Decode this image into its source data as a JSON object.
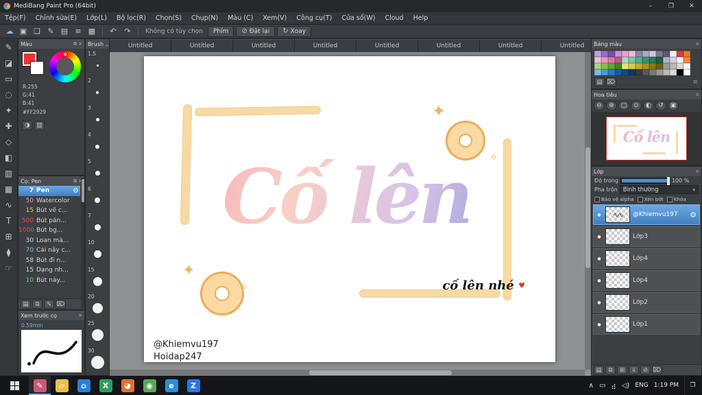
{
  "icons": {
    "close": "×",
    "collapse": "⧉",
    "gear": "⚙",
    "eye": "●",
    "caret": "▾",
    "undo": "↶",
    "redo": "↷",
    "block": "⊘",
    "rotate": "↻",
    "handle": "≡",
    "sparkle": "✦",
    "sparkle_small": "✧",
    "heart": "♥",
    "action_center": "❐"
  },
  "titlebar": {
    "title": "MediBang Paint Pro (64bit)",
    "window_buttons": {
      "minimize": "–",
      "maximize": "❐",
      "close": "✕"
    }
  },
  "menu": {
    "items": [
      "Tệp(F)",
      "Chỉnh sửa(E)",
      "Lớp(L)",
      "Bộ lọc(R)",
      "Chọn(S)",
      "Chụp(N)",
      "Màu (C)",
      "Xem(V)",
      "Công cụ(T)",
      "Cửa sổ(W)",
      "Cloud",
      "Help"
    ]
  },
  "toolbar": {
    "icons": [
      {
        "name": "cloud-icon",
        "glyph": "☁"
      },
      {
        "name": "save-icon",
        "glyph": "▣"
      },
      {
        "name": "comment-icon",
        "glyph": "❏"
      },
      {
        "name": "brush-icon",
        "glyph": "✎"
      },
      {
        "name": "material-icon",
        "glyph": "▤"
      },
      {
        "name": "list-icon",
        "glyph": "≡"
      },
      {
        "name": "grid-icon",
        "glyph": "▦"
      }
    ],
    "no_option_label": "Không có tùy chọn",
    "keys_button": "Phím",
    "reset_button": "Đặt lại",
    "rotate_button": "Xoay"
  },
  "tabs": [
    "Untitled",
    "Untitled",
    "Untitled",
    "Untitled",
    "Untitled",
    "Untitled",
    "Untitled",
    "Untitled"
  ],
  "tools": [
    {
      "name": "pen-tool",
      "glyph": "✎"
    },
    {
      "name": "eraser-tool",
      "glyph": "◪"
    },
    {
      "name": "select-tool",
      "glyph": "▭"
    },
    {
      "name": "lasso-tool",
      "glyph": "◌"
    },
    {
      "name": "magic-wand-tool",
      "glyph": "✦"
    },
    {
      "name": "move-tool",
      "glyph": "✚"
    },
    {
      "name": "transform-tool",
      "glyph": "◇"
    },
    {
      "name": "bucket-tool",
      "glyph": "◧"
    },
    {
      "name": "gradient-tool",
      "glyph": "▥"
    },
    {
      "name": "shape-tool",
      "glyph": "▦"
    },
    {
      "name": "curve-tool",
      "glyph": "∿"
    },
    {
      "name": "text-tool",
      "glyph": "T"
    },
    {
      "name": "frame-tool",
      "glyph": "⊞"
    },
    {
      "name": "eyedropper-tool",
      "glyph": "⧫"
    },
    {
      "name": "hand-tool",
      "glyph": "☞",
      "color": "#7fc4e8"
    }
  ],
  "color_panel": {
    "title": "Màu",
    "r": "R:255",
    "g": "G:41",
    "b": "B:41",
    "hex": "#FF2929",
    "foreground_color": "#ee3333",
    "background_color": "#ffffff",
    "bottom_icons": [
      {
        "name": "swap-colors-icon",
        "glyph": "◑"
      },
      {
        "name": "color-slider-icon",
        "glyph": "▥"
      }
    ]
  },
  "brush_panel": {
    "title": "Cọ: Pen",
    "brushes": [
      {
        "size": "7",
        "name": "Pen",
        "selected": true
      },
      {
        "size": "50",
        "name": "Watercolor",
        "size_color": "#e89ab8"
      },
      {
        "size": "15",
        "name": "Bút vẽ c...",
        "size_color": "#e8d44a"
      },
      {
        "size": "500",
        "name": "Bút pản...",
        "size_color": "#e84848"
      },
      {
        "size": "1000",
        "name": "Bút bg...",
        "size_color": "#e84848"
      },
      {
        "size": "30",
        "name": "Loan mà...",
        "size_color": "#d8d8d8"
      },
      {
        "size": "70",
        "name": "Cải nãy c...",
        "size_color": "#8fb8e8"
      },
      {
        "size": "58",
        "name": "Bút đi n...",
        "size_color": "#d8d8d8"
      },
      {
        "size": "15",
        "name": "Dạng nh...",
        "size_color": "#d8d8d8"
      },
      {
        "size": "10",
        "name": "Bút này...",
        "size_color": "#7ac84a"
      }
    ],
    "bottom_icons": [
      {
        "name": "new-brush-icon",
        "glyph": "▤"
      },
      {
        "name": "duplicate-brush-icon",
        "glyph": "⧉"
      },
      {
        "name": "edit-brush-icon",
        "glyph": "✎"
      },
      {
        "name": "delete-brush-icon",
        "glyph": "⌦"
      }
    ]
  },
  "size_panel": {
    "title": "Brush ...",
    "sizes": [
      {
        "label": "1.5",
        "dot": 3
      },
      {
        "label": "2",
        "dot": 4
      },
      {
        "label": "3",
        "dot": 5
      },
      {
        "label": "4",
        "dot": 6
      },
      {
        "label": "5",
        "dot": 7
      },
      {
        "label": "6",
        "dot": 8
      },
      {
        "label": "7",
        "dot": 9
      },
      {
        "label": "10",
        "dot": 11
      },
      {
        "label": "15",
        "dot": 13
      },
      {
        "label": "20",
        "dot": 15
      },
      {
        "label": "25",
        "dot": 17
      },
      {
        "label": "30",
        "dot": 19
      }
    ]
  },
  "preview_panel": {
    "title": "Xem trước cọ",
    "size_label": "0.59mm"
  },
  "palette_panel": {
    "title": "Bảng màu",
    "colors": [
      "#b9a3d8",
      "#9a6cc9",
      "#7b4cb2",
      "#c892d8",
      "#e8a2d0",
      "#f0bad8",
      "#8a8aa2",
      "#a9a9c1",
      "#c9c9e0",
      "#7a7a92",
      "#5a5a72",
      "#f0f0f0",
      "#e03a3a",
      "#e87a2a",
      "#f0c2d2",
      "#e89aba",
      "#d87a9a",
      "#c05a7a",
      "#aad8c2",
      "#7ac8a2",
      "#4ab282",
      "#3a926a",
      "#2a7a52",
      "#1a6242",
      "#b2b2c2",
      "#d2d2e2",
      "#f2f2fa",
      "#f08a3a",
      "#aad87a",
      "#82c252",
      "#5aaa32",
      "#3a8a1a",
      "#e8e272",
      "#d8ca4a",
      "#c2aa32",
      "#aa9222",
      "#8a7a12",
      "#6a620a",
      "#9a9a9a",
      "#bababa",
      "#dadada",
      "#fafafa",
      "#7abae8",
      "#4a9ada",
      "#2a7ac2",
      "#1a5aa2",
      "#124a82",
      "#0a3a62",
      "#3a3a3a",
      "#5a5a5a",
      "#7a7a7a",
      "#9a9a9a",
      "#bababa",
      "#dadada",
      "#000000",
      "#ffffff"
    ],
    "bottom_icons": [
      {
        "name": "add-swatch-icon",
        "glyph": "▤"
      },
      {
        "name": "delete-swatch-icon",
        "glyph": "⌦"
      }
    ]
  },
  "navigator_panel": {
    "title": "Hoa tiêu",
    "tools": [
      {
        "name": "zoom-out-icon",
        "glyph": "⊖"
      },
      {
        "name": "zoom-in-icon",
        "glyph": "⊕"
      },
      {
        "name": "fit-window-icon",
        "glyph": "▢"
      },
      {
        "name": "original-size-icon",
        "glyph": "⊙"
      },
      {
        "name": "rotate-reset-icon",
        "glyph": "◐"
      },
      {
        "name": "rotate-ccw-icon",
        "glyph": "↺"
      },
      {
        "name": "fullscreen-icon",
        "glyph": "▣"
      }
    ]
  },
  "layers_panel": {
    "title": "Lớp",
    "opacity_label": "Độ trong",
    "opacity_value": "100 %",
    "blend_label": "Pha trộn",
    "blend_value": "Bình thường",
    "alpha_lock_label": "Bảo vệ alpha",
    "clip_label": "Xén bớt",
    "lock_label": "Khóa",
    "layers": [
      {
        "name": "@Khiemvu197",
        "selected": true
      },
      {
        "name": "Lớp3"
      },
      {
        "name": "Lớp4"
      },
      {
        "name": "Lớp4"
      },
      {
        "name": "Lớp2"
      },
      {
        "name": "Lớp1"
      }
    ],
    "bottom_icons": [
      {
        "name": "new-layer-icon",
        "glyph": "▤"
      },
      {
        "name": "duplicate-layer-icon",
        "glyph": "⧉"
      },
      {
        "name": "layer-folder-icon",
        "glyph": "⊞"
      },
      {
        "name": "merge-down-icon",
        "glyph": "⇓"
      },
      {
        "name": "clear-layer-icon",
        "glyph": "⊘"
      },
      {
        "name": "delete-layer-icon",
        "glyph": "⌦"
      }
    ]
  },
  "canvas": {
    "lettering": "Cố lên",
    "note_text": "cố lên nhé",
    "credit_line1": "@Khiemvu197",
    "credit_line2": "Hoidap247",
    "accent_cream": "#f7d9a4",
    "accent_orange": "#eeab55",
    "gradient_pink": "#f6b3ba",
    "gradient_purple": "#a4a3d8"
  },
  "taskbar": {
    "apps": [
      {
        "name": "medibang",
        "glyph": "✎",
        "bg": "#c85a78",
        "active": true
      },
      {
        "name": "file-explorer",
        "glyph": "▱",
        "bg": "#e8c04a"
      },
      {
        "name": "store",
        "glyph": "⌂",
        "bg": "#2f7fd6"
      },
      {
        "name": "excel",
        "glyph": "X",
        "bg": "#2e9e5b"
      },
      {
        "name": "firefox",
        "glyph": "◕",
        "bg": "#e8702a"
      },
      {
        "name": "chrome",
        "glyph": "◉",
        "bg": "#58a858"
      },
      {
        "name": "edge",
        "glyph": "e",
        "bg": "#2a8fd8"
      },
      {
        "name": "zalo",
        "glyph": "Z",
        "bg": "#2a76e8"
      }
    ],
    "tray_icons": [
      {
        "name": "tray-expand-icon",
        "glyph": "∧"
      },
      {
        "name": "pc-icon",
        "glyph": "▭"
      },
      {
        "name": "network-icon",
        "glyph": "⣴"
      },
      {
        "name": "volume-icon",
        "glyph": "◁)"
      }
    ],
    "language": "ENG",
    "time": "1:19 PM"
  }
}
